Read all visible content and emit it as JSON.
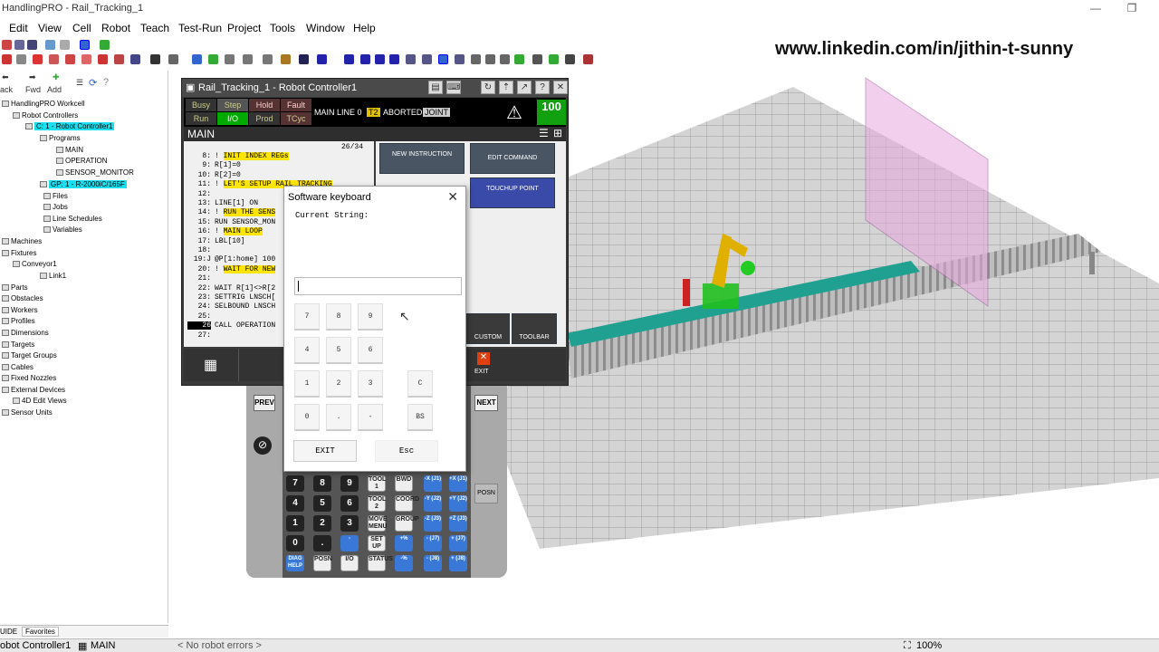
{
  "window": {
    "title": "HandlingPRO - Rail_Tracking_1"
  },
  "menu": [
    "Edit",
    "View",
    "Cell",
    "Robot",
    "Teach",
    "Test-Run",
    "Project",
    "Tools",
    "Window",
    "Help"
  ],
  "banner": "www.linkedin.com/in/jithin-t-sunny",
  "nav": {
    "back": "ack",
    "fwd": "Fwd",
    "add": "Add"
  },
  "tree": [
    {
      "label": "HandlingPRO Workcell",
      "hl": false
    },
    {
      "label": "Robot Controllers",
      "hl": false
    },
    {
      "label": "C: 1 - Robot Controller1",
      "hl": true
    },
    {
      "label": "Programs",
      "hl": false
    },
    {
      "label": "MAIN",
      "hl": false
    },
    {
      "label": "OPERATION",
      "hl": false
    },
    {
      "label": "SENSOR_MONITOR",
      "hl": false
    },
    {
      "label": "GP: 1 - R-2000iC/165F",
      "hl": true
    },
    {
      "label": "Files",
      "hl": false
    },
    {
      "label": "Jobs",
      "hl": false
    },
    {
      "label": "Line Schedules",
      "hl": false
    },
    {
      "label": "Variables",
      "hl": false
    },
    {
      "label": "Machines",
      "hl": false
    },
    {
      "label": "Fixtures",
      "hl": false
    },
    {
      "label": "Conveyor1",
      "hl": false
    },
    {
      "label": "Link1",
      "hl": false
    },
    {
      "label": "Parts",
      "hl": false
    },
    {
      "label": "Obstacles",
      "hl": false
    },
    {
      "label": "Workers",
      "hl": false
    },
    {
      "label": "Profiles",
      "hl": false
    },
    {
      "label": "Dimensions",
      "hl": false
    },
    {
      "label": "Targets",
      "hl": false
    },
    {
      "label": "Target Groups",
      "hl": false
    },
    {
      "label": "Cables",
      "hl": false
    },
    {
      "label": "Fixed Nozzles",
      "hl": false
    },
    {
      "label": "External Devices",
      "hl": false
    },
    {
      "label": "4D Edit Views",
      "hl": false
    },
    {
      "label": "Sensor Units",
      "hl": false
    }
  ],
  "bottom_tabs": [
    "UIDE",
    "Favorites"
  ],
  "status": {
    "left": "obot Controller1",
    "prog": "MAIN",
    "errors": "< No robot errors >",
    "zoom": "100%"
  },
  "tp": {
    "title": "Rail_Tracking_1 - Robot Controller1",
    "flags": {
      "busy": "Busy",
      "step": "Step",
      "hold": "Hold",
      "fault": "Fault",
      "run": "Run",
      "io": "I/O",
      "prod": "Prod",
      "tcyc": "TCyc"
    },
    "line_status": "MAIN LINE 0",
    "t2": "T2",
    "aborted": "ABORTED",
    "joint": "JOINT",
    "override": "100",
    "override_unit": "%",
    "header": "MAIN",
    "counter": "26/34",
    "lines": [
      {
        "n": "8:",
        "t": "!",
        "y": "INIT INDEX REGs"
      },
      {
        "n": "9:",
        "t": "R[1]=0",
        "y": ""
      },
      {
        "n": "10:",
        "t": "R[2]=0",
        "y": ""
      },
      {
        "n": "11:",
        "t": "!",
        "y": "LET'S SETUP RAIL TRACKING"
      },
      {
        "n": "12:",
        "t": "",
        "y": ""
      },
      {
        "n": "13:",
        "t": "LINE[1] ON",
        "y": ""
      },
      {
        "n": "14:",
        "t": "!",
        "y": "RUN THE SENS"
      },
      {
        "n": "15:",
        "t": "RUN SENSOR_MON",
        "y": ""
      },
      {
        "n": "16:",
        "t": "!",
        "y": "MAIN LOOP"
      },
      {
        "n": "17:",
        "t": "LBL[10]",
        "y": ""
      },
      {
        "n": "18:",
        "t": "",
        "y": ""
      },
      {
        "n": "19:J",
        "t": "@P[1:home] 100",
        "y": ""
      },
      {
        "n": "20:",
        "t": "!",
        "y": "WAIT FOR NEW"
      },
      {
        "n": "21:",
        "t": "",
        "y": ""
      },
      {
        "n": "22:",
        "t": "WAIT R[1]<>R[2",
        "y": ""
      },
      {
        "n": "23:",
        "t": "SETTRIG LNSCH[",
        "y": ""
      },
      {
        "n": "24:",
        "t": "SELBOUND LNSCH",
        "y": ""
      },
      {
        "n": "25:",
        "t": "",
        "y": ""
      },
      {
        "n": "26",
        "t": "CALL OPERATION",
        "y": ""
      },
      {
        "n": "27:",
        "t": "",
        "y": ""
      }
    ],
    "btn_new": "NEW INSTRUCTION",
    "btn_edit": "EDIT COMMAND",
    "btn_touchup": "TOUCHUP POINT",
    "btn_custom": "CUSTOM",
    "btn_toolbar": "TOOLBAR",
    "btn_exit": "EXIT",
    "prev": "PREV",
    "next": "NEXT",
    "posn": "POSN"
  },
  "pendant_keys": [
    [
      "7",
      "8",
      "9",
      "TOOL 1",
      "BWD",
      "-X (J1)",
      "+X (J1)"
    ],
    [
      "4",
      "5",
      "6",
      "TOOL 2",
      "COORD",
      "-Y (J2)",
      "+Y (J2)"
    ],
    [
      "1",
      "2",
      "3",
      "MOVE MENU",
      "GROUP",
      "-Z (J3)",
      "+Z (J3)"
    ],
    [
      "0",
      ".",
      "-",
      "SET UP",
      "+%",
      "- (J7)",
      "+ (J7)"
    ],
    [
      "DIAG HELP",
      "POSN",
      "I/O",
      "STATUS",
      "-%",
      "- (J8)",
      "+ (J8)"
    ]
  ],
  "keyboard": {
    "title": "Software keyboard",
    "close": "✕",
    "current": "Current String:",
    "keys": [
      [
        "7",
        "8",
        "9"
      ],
      [
        "4",
        "5",
        "6"
      ],
      [
        "1",
        "2",
        "3",
        "C"
      ],
      [
        "0",
        ".",
        "-",
        "BS"
      ]
    ],
    "exit": "EXIT",
    "esc": "Esc"
  },
  "colors": {
    "accent": "#19e0f0",
    "tp_green": "#10a010",
    "robot": "#e0b000",
    "conveyor": "#1fa090"
  }
}
